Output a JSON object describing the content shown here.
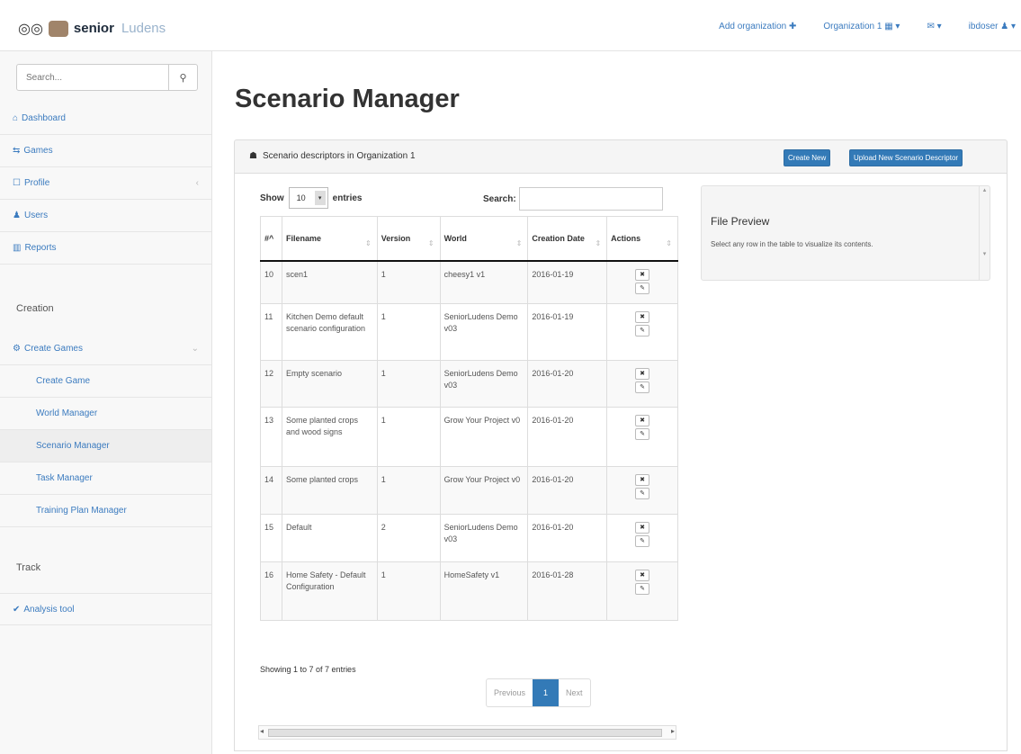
{
  "brand": {
    "name_bold": "senior",
    "name_light": "Ludens"
  },
  "topnav": {
    "add_org": "Add organization ✚",
    "organization": "Organization 1 ▦ ▾",
    "inbox": "✉ ▾",
    "user": "ibdoser ♟ ▾"
  },
  "sidebar": {
    "search_placeholder": "Search...",
    "items": [
      {
        "icon": "⌂",
        "label": "Dashboard"
      },
      {
        "icon": "⇆",
        "label": "Games"
      },
      {
        "icon": "☐",
        "label": "Profile"
      },
      {
        "icon": "♟",
        "label": "Users"
      },
      {
        "icon": "▥",
        "label": "Reports"
      }
    ],
    "section_creation": "Creation",
    "create_games": {
      "icon": "⚙",
      "label": "Create Games"
    },
    "sub_items": [
      {
        "label": "Create Game"
      },
      {
        "label": "World Manager"
      },
      {
        "label": "Scenario Manager"
      },
      {
        "label": "Task Manager"
      },
      {
        "label": "Training Plan Manager"
      }
    ],
    "section_track": "Track",
    "analysis_tool": {
      "icon": "✔",
      "label": "Analysis tool"
    }
  },
  "page": {
    "title": "Scenario Manager"
  },
  "panel": {
    "icon": "☗",
    "title": "Scenario descriptors in Organization 1",
    "create_new": "Create New",
    "upload_new": "Upload New Scenario Descriptor"
  },
  "datatable": {
    "show_label": "Show",
    "entries_value": "10",
    "entries_label": "entries",
    "search_label": "Search:",
    "columns": [
      "#^",
      "Filename",
      "Version",
      "World",
      "Creation Date",
      "Actions"
    ],
    "rows": [
      {
        "id": "10",
        "filename": "scen1",
        "version": "1",
        "world": "cheesy1 v1",
        "date": "2016-01-19"
      },
      {
        "id": "11",
        "filename": "Kitchen Demo default scenario configuration",
        "version": "1",
        "world": "SeniorLudens Demo v03",
        "date": "2016-01-19"
      },
      {
        "id": "12",
        "filename": "Empty scenario",
        "version": "1",
        "world": "SeniorLudens Demo v03",
        "date": "2016-01-20"
      },
      {
        "id": "13",
        "filename": "Some planted crops and wood signs",
        "version": "1",
        "world": "Grow Your Project v0",
        "date": "2016-01-20"
      },
      {
        "id": "14",
        "filename": "Some planted crops",
        "version": "1",
        "world": "Grow Your Project v0",
        "date": "2016-01-20"
      },
      {
        "id": "15",
        "filename": "Default",
        "version": "2",
        "world": "SeniorLudens Demo v03",
        "date": "2016-01-20"
      },
      {
        "id": "16",
        "filename": "Home Safety - Default Configuration",
        "version": "1",
        "world": "HomeSafety v1",
        "date": "2016-01-28"
      }
    ],
    "info": "Showing 1 to 7 of 7 entries",
    "pager": {
      "previous": "Previous",
      "current": "1",
      "next": "Next"
    }
  },
  "preview": {
    "title": "File Preview",
    "description": "Select any row in the table to visualize its contents."
  },
  "colors": {
    "accent": "#337ab7",
    "link": "#3b7bbf"
  }
}
